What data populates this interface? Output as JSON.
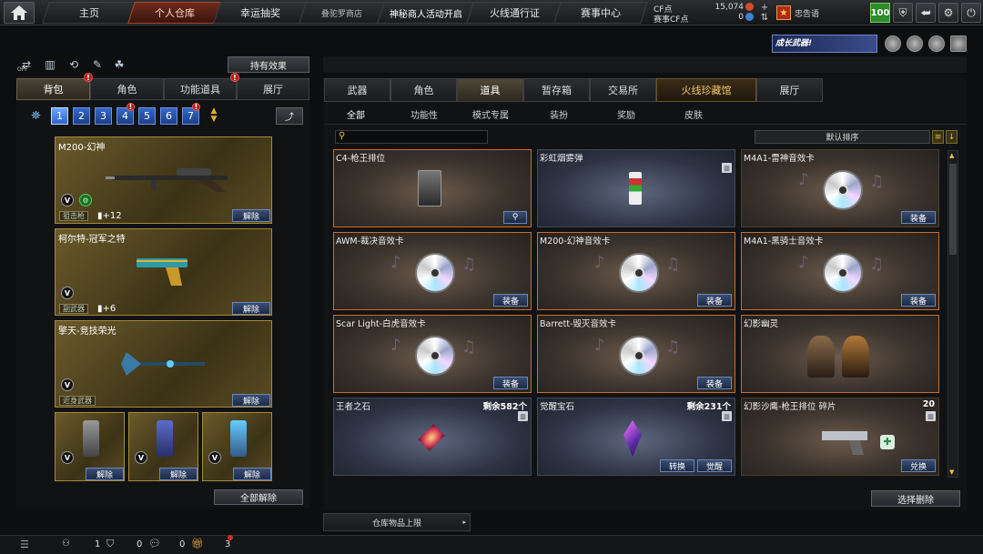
{
  "nav": {
    "tabs": [
      "主页",
      "个人仓库",
      "幸运抽奖",
      "叠驼罗商店",
      "神秘商人活动开启",
      "火线通行证",
      "赛事中心"
    ],
    "active_tab": "个人仓库",
    "cf_label": "CF点",
    "cf_value": "15,074",
    "event_cf_label": "赛事CF点",
    "event_cf_value": "0",
    "clan_name": "忠告语",
    "level": "100"
  },
  "promo": {
    "text": "成长武器!"
  },
  "left": {
    "off_label": "OFF",
    "hold_effect_button": "持有效果",
    "tabs": [
      "背包",
      "角色",
      "功能道具",
      "展厅"
    ],
    "active_tab": "背包",
    "pages": [
      "1",
      "2",
      "3",
      "4",
      "5",
      "6",
      "7"
    ],
    "active_page": "1",
    "equipped": [
      {
        "name": "M200-幻神",
        "category": "狙击枪",
        "extra": "+12"
      },
      {
        "name": "柯尔特-冠军之特",
        "category": "副武器",
        "extra": "+6"
      },
      {
        "name": "擎天-竞技荣光",
        "category": "近身武器",
        "extra": ""
      }
    ],
    "unequip_label": "解除",
    "unequip_all_button": "全部解除"
  },
  "right": {
    "tabs": [
      "武器",
      "角色",
      "道具",
      "暂存箱",
      "交易所",
      "火线珍藏馆",
      "展厅"
    ],
    "active_tab": "道具",
    "subtabs": [
      "全部",
      "功能性",
      "模式专属",
      "装扮",
      "奖励",
      "皮肤"
    ],
    "active_subtab": "全部",
    "search_placeholder": "",
    "sort_label": "默认排序",
    "equip_label": "装备",
    "items": [
      {
        "name": "C4-枪王排位",
        "count": "",
        "buttons": [],
        "type": "c4"
      },
      {
        "name": "彩虹烟雾弹",
        "count": "",
        "buttons": [],
        "type": "smoke"
      },
      {
        "name": "M4A1-雷神音效卡",
        "count": "",
        "buttons": [
          "装备"
        ],
        "type": "cd"
      },
      {
        "name": "AWM-裁决音效卡",
        "count": "",
        "buttons": [
          "装备"
        ],
        "type": "cd"
      },
      {
        "name": "M200-幻神音效卡",
        "count": "",
        "buttons": [
          "装备"
        ],
        "type": "cd"
      },
      {
        "name": "M4A1-黑骑士音效卡",
        "count": "",
        "buttons": [
          "装备"
        ],
        "type": "cd"
      },
      {
        "name": "Scar Light-白虎音效卡",
        "count": "",
        "buttons": [
          "装备"
        ],
        "type": "cd"
      },
      {
        "name": "Barrett-毁灭音效卡",
        "count": "",
        "buttons": [
          "装备"
        ],
        "type": "cd"
      },
      {
        "name": "幻影幽灵",
        "count": "",
        "buttons": [],
        "type": "ghost"
      },
      {
        "name": "王者之石",
        "count": "剩余582个",
        "buttons": [],
        "type": "stone"
      },
      {
        "name": "觉醒宝石",
        "count": "剩余231个",
        "buttons": [
          "转换",
          "觉醒"
        ],
        "type": "gem"
      },
      {
        "name": "幻影沙鹰-枪王排位 碎片",
        "count": "20",
        "buttons": [
          "兑换"
        ],
        "type": "deagle"
      }
    ],
    "select_delete_button": "选择删除",
    "storage_label": "仓库物品上限"
  },
  "bottom": {
    "count1": "1",
    "count2": "0",
    "count3": "0",
    "count4": "3"
  },
  "colors": {
    "accent": "#c96b2a",
    "equip_blue": "#3a4d72",
    "gold_card": "#a5893b"
  }
}
